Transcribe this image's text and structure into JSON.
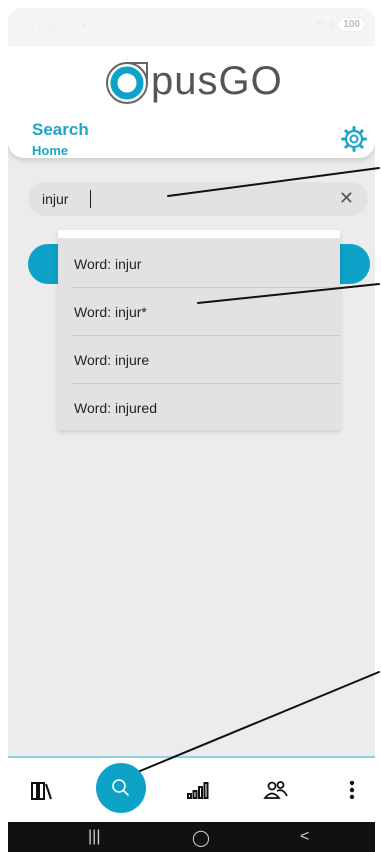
{
  "status_bar": {
    "time": "17:34",
    "battery": "100"
  },
  "header": {
    "logo_opus": "pus",
    "logo_go": "GO",
    "title": "Search",
    "subtitle": "Home"
  },
  "search": {
    "value": "injur",
    "clear_label": "✕"
  },
  "dropdown": {
    "items": [
      "Word: injur",
      "Word: injur*",
      "Word: injure",
      "Word: injured"
    ]
  },
  "bottom_nav": {
    "items": [
      "library-icon",
      "search-icon",
      "stats-icon",
      "users-icon",
      "more-icon"
    ]
  },
  "system_nav": {
    "recent": "|||",
    "home": "◯",
    "back": "<"
  },
  "colors": {
    "accent": "#0da2c8",
    "text_accent": "#1ba6c9",
    "background": "#ececec"
  }
}
